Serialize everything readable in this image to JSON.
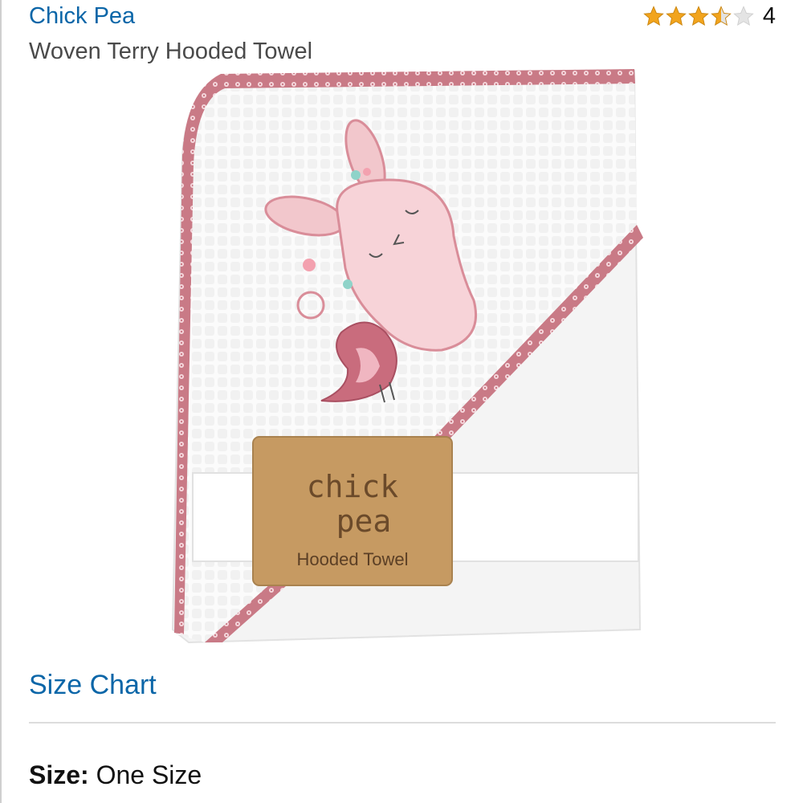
{
  "header": {
    "brand": "Chick Pea",
    "title": "Woven Terry Hooded Towel",
    "rating": {
      "stars": 3.5,
      "max_stars": 5,
      "count": "4"
    }
  },
  "product_image": {
    "icon": "hooded-towel-product-photo",
    "tag": {
      "line1": "chick",
      "line2": "pea",
      "line3": "Hooded Towel"
    }
  },
  "size_chart": {
    "label": "Size Chart"
  },
  "size": {
    "label": "Size:",
    "value": "One Size"
  },
  "colors": {
    "link": "#0b66a8",
    "star": "#f2a41d",
    "star_empty": "#d8d8d8",
    "trim": "#c97a86",
    "tag": "#c69a62"
  }
}
